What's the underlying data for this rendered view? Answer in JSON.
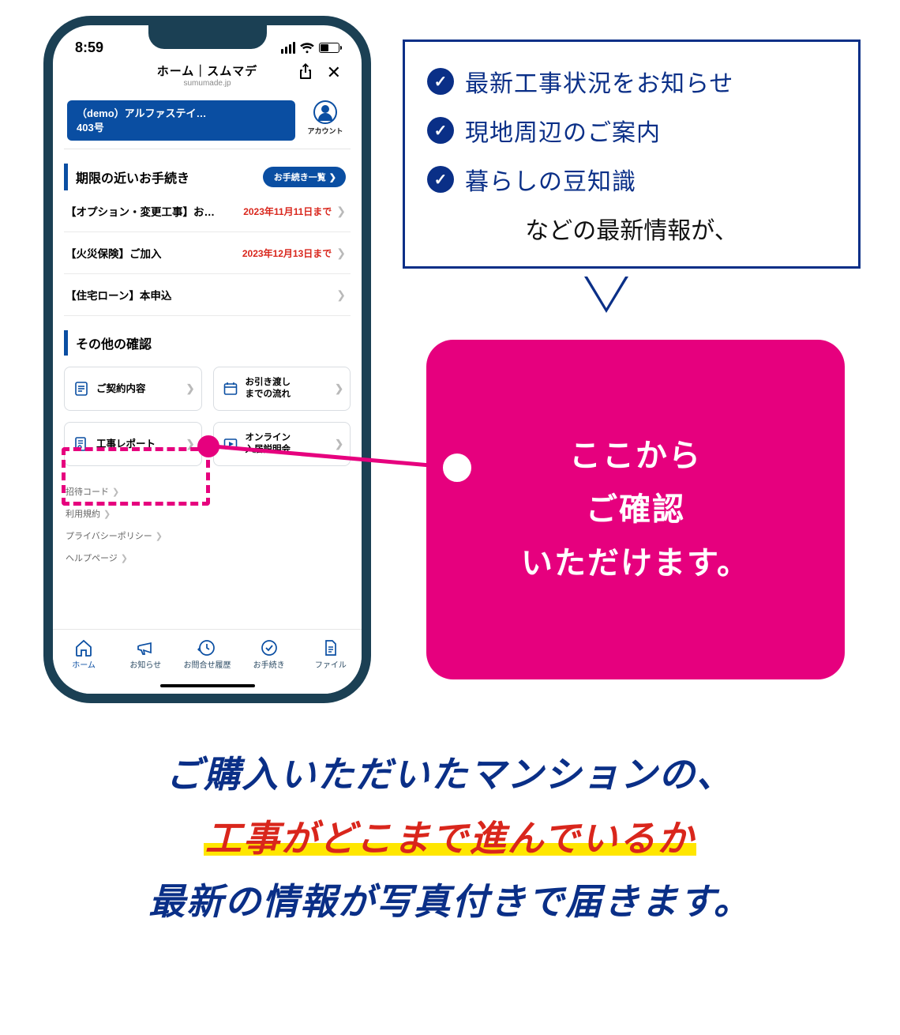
{
  "phone": {
    "time": "8:59",
    "browser_title": "ホーム｜スムマデ",
    "browser_url": "sumumade.jp",
    "property_chip_line1": "（demo）アルファステイ…",
    "property_chip_line2": "403号",
    "account_label": "アカウント",
    "section_todo_title": "期限の近いお手続き",
    "todo_list_btn": "お手続き一覧",
    "todos": [
      {
        "title": "【オプション・変更工事】お…",
        "deadline": "2023年11月11日まで"
      },
      {
        "title": "【火災保険】ご加入",
        "deadline": "2023年12月13日まで"
      },
      {
        "title": "【住宅ローン】本申込",
        "deadline": ""
      }
    ],
    "section_other_title": "その他の確認",
    "grid": [
      {
        "label": "ご契約内容"
      },
      {
        "label": "お引き渡し\nまでの流れ"
      },
      {
        "label": "工事レポート"
      },
      {
        "label": "オンライン\n入居説明会"
      }
    ],
    "footer_links": [
      "招待コード",
      "利用規約",
      "プライバシーポリシー",
      "ヘルプページ"
    ],
    "tabs": [
      "ホーム",
      "お知らせ",
      "お問合せ履歴",
      "お手続き",
      "ファイル"
    ]
  },
  "callout": {
    "items": [
      "最新工事状況をお知らせ",
      "現地周辺のご案内",
      "暮らしの豆知識"
    ],
    "tail": "などの最新情報が、"
  },
  "pink_card": {
    "line1": "ここから",
    "line2": "ご確認",
    "line3": "いただけます。"
  },
  "bottom": {
    "line1": "ご購入いただいたマンションの、",
    "line2": "工事がどこまで進んでいるか",
    "line3": "最新の情報が写真付きで届きます。"
  }
}
